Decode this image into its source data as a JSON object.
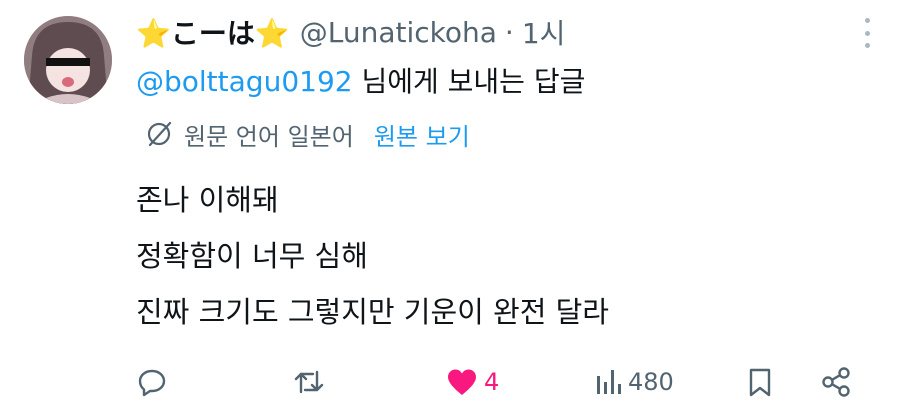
{
  "tweet": {
    "author": {
      "display_name": "⭐こーは⭐",
      "handle": "@Lunatickoha",
      "separator": "·",
      "time": "1시"
    },
    "reply_to": {
      "mention": "@bolttagu0192",
      "suffix": " 님에게 보내는 답글"
    },
    "translation": {
      "note": "원문 언어 일본어",
      "show_original": "원본 보기"
    },
    "text_lines": [
      "존나 이해돼",
      "정확함이 너무 심해",
      "진짜 크기도 그렇지만 기운이 완전 달라"
    ],
    "stats": {
      "likes": "4",
      "views": "480"
    }
  },
  "colors": {
    "accent": "#1d9bf0",
    "like": "#f91880",
    "muted": "#536471"
  },
  "icons": [
    "avatar",
    "more-icon",
    "globe-slash-icon",
    "reply-icon",
    "retweet-icon",
    "heart-icon",
    "views-icon",
    "bookmark-icon",
    "share-icon"
  ]
}
